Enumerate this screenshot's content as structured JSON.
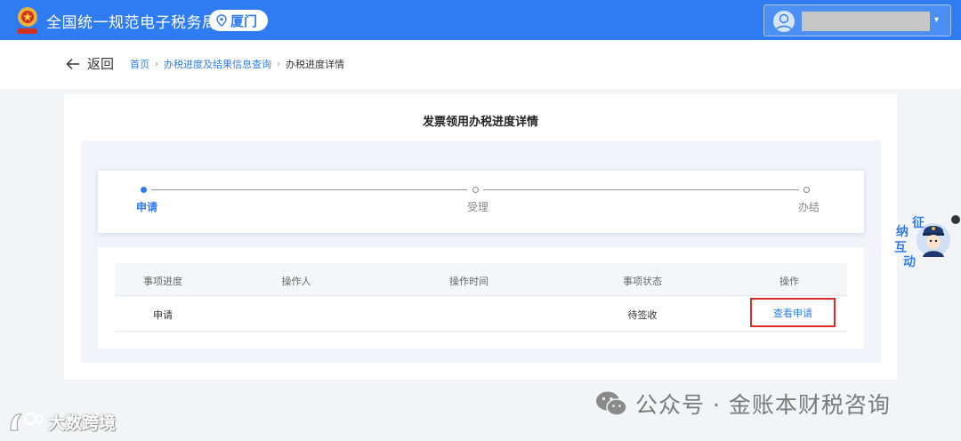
{
  "header": {
    "site_title": "全国统一规范电子税务局",
    "city": "厦门",
    "user_menu_caret": "▾"
  },
  "breadcrumb": {
    "back_label": "返回",
    "items": [
      "首页",
      "办税进度及结果信息查询",
      "办税进度详情"
    ],
    "separator": "›"
  },
  "card": {
    "title": "发票领用办税进度详情"
  },
  "steps": [
    {
      "label": "申请",
      "state": "active"
    },
    {
      "label": "受理",
      "state": "pending"
    },
    {
      "label": "办结",
      "state": "pending"
    }
  ],
  "table": {
    "columns": [
      "事项进度",
      "操作人",
      "操作时间",
      "事项状态",
      "操作"
    ],
    "rows": [
      {
        "progress": "申请",
        "operator": "",
        "time": "",
        "status": "待签收",
        "action": "查看申请"
      }
    ]
  },
  "float_widget": {
    "chars": [
      "征",
      "纳",
      "互",
      "动"
    ]
  },
  "watermark": {
    "right": "公众号 · 金账本财税咨询",
    "left": "大数跨境"
  },
  "colors": {
    "primary": "#2f7cf2",
    "highlight_border": "#e02a2a",
    "background": "#f3f4f7"
  }
}
